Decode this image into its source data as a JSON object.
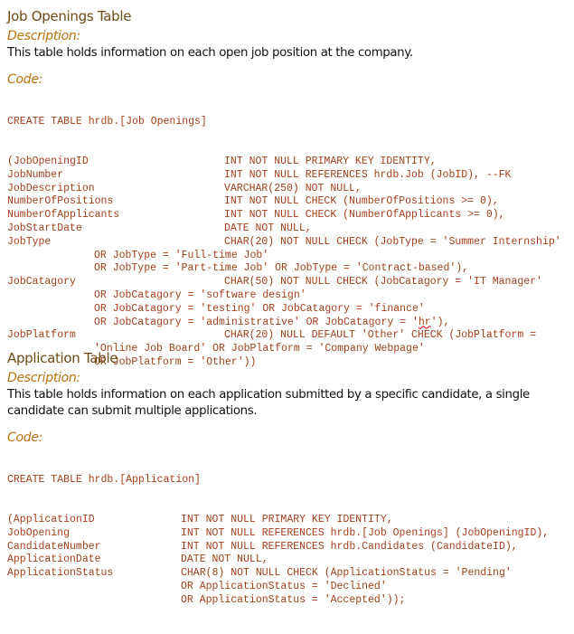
{
  "job_openings": {
    "title": "Job Openings Table",
    "description_label": "Description:",
    "description": "This table holds information on each open job position at the company.",
    "code_label": "Code:",
    "create_line": "CREATE TABLE hrdb.[Job Openings]",
    "rows": [
      {
        "col": "(JobOpeningID",
        "def": "INT NOT NULL PRIMARY KEY IDENTITY,"
      },
      {
        "col": "JobNumber",
        "def": "INT NOT NULL REFERENCES hrdb.Job (JobID), --FK"
      },
      {
        "col": "JobDescription",
        "def": "VARCHAR(250) NOT NULL,"
      },
      {
        "col": "NumberOfPositions",
        "def": "INT NOT NULL CHECK (NumberOfPositions >= 0),"
      },
      {
        "col": "NumberOfApplicants",
        "def": "INT NOT NULL CHECK (NumberOfApplicants >= 0),"
      },
      {
        "col": "JobStartDate",
        "def": "DATE NOT NULL,"
      },
      {
        "col": "JobType",
        "def": "CHAR(20) NOT NULL CHECK (JobType = 'Summer Internship'"
      },
      {
        "cont": "OR JobType = 'Full-time Job'"
      },
      {
        "cont": "OR JobType = 'Part-time Job' OR JobType = 'Contract-based'),"
      },
      {
        "col": "JobCatagory",
        "def": "CHAR(50) NOT NULL CHECK (JobCatagory = 'IT Manager'"
      },
      {
        "cont": "OR JobCatagory = 'software design'"
      },
      {
        "cont": "OR JobCatagory = 'testing' OR JobCatagory = 'finance'"
      },
      {
        "cont_pre": "OR JobCatagory = 'administrative' OR JobCatagory = '",
        "cont_mark": "hr",
        "cont_post": "'),"
      },
      {
        "col": "JobPlatform",
        "def": "CHAR(20) NULL DEFAULT 'Other' CHECK (JobPlatform ="
      },
      {
        "cont": "'Online Job Board' OR JobPlatform = 'Company Webpage'"
      },
      {
        "cont": "OR JobPlatform = 'Other'))"
      }
    ]
  },
  "application": {
    "title": "Application Table",
    "description_label": "Description:",
    "description": "This table holds information on each application submitted by a specific candidate, a single candidate can submit multiple applications.",
    "code_label": "Code:",
    "create_line": "CREATE TABLE hrdb.[Application]",
    "rows": [
      {
        "col": "(ApplicationID",
        "def": "INT NOT NULL PRIMARY KEY IDENTITY,"
      },
      {
        "col": "JobOpening",
        "def": "INT NOT NULL REFERENCES hrdb.[Job Openings] (JobOpeningID),"
      },
      {
        "col": "CandidateNumber",
        "def": "INT NOT NULL REFERENCES hrdb.Candidates (CandidateID),"
      },
      {
        "col": "ApplicationDate",
        "def": "DATE NOT NULL,"
      },
      {
        "col": "ApplicationStatus",
        "def": "CHAR(8) NOT NULL CHECK (ApplicationStatus = 'Pending'"
      },
      {
        "col": "",
        "def": "OR ApplicationStatus = 'Declined'"
      },
      {
        "col": "",
        "def": "OR ApplicationStatus = 'Accepted'));"
      }
    ]
  }
}
